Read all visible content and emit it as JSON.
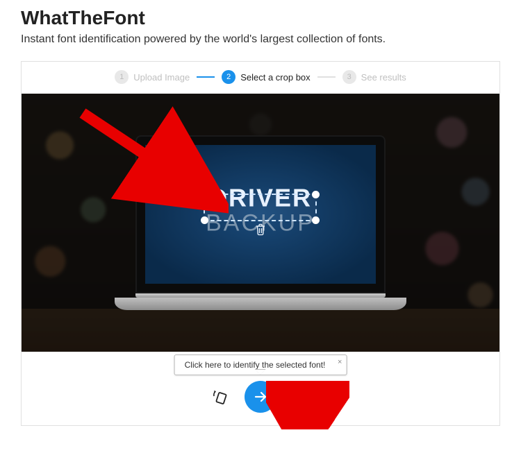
{
  "header": {
    "title": "WhatTheFont",
    "subtitle": "Instant font identification powered by the world's largest collection of fonts."
  },
  "steps": {
    "items": [
      {
        "num": "1",
        "label": "Upload Image"
      },
      {
        "num": "2",
        "label": "Select a crop box"
      },
      {
        "num": "3",
        "label": "See results"
      }
    ],
    "active_index": 1
  },
  "image": {
    "text_line1": "DRIVER",
    "text_line2": "BACKUP"
  },
  "tooltip": {
    "text": "Click here to identify the selected font!",
    "close": "×"
  }
}
